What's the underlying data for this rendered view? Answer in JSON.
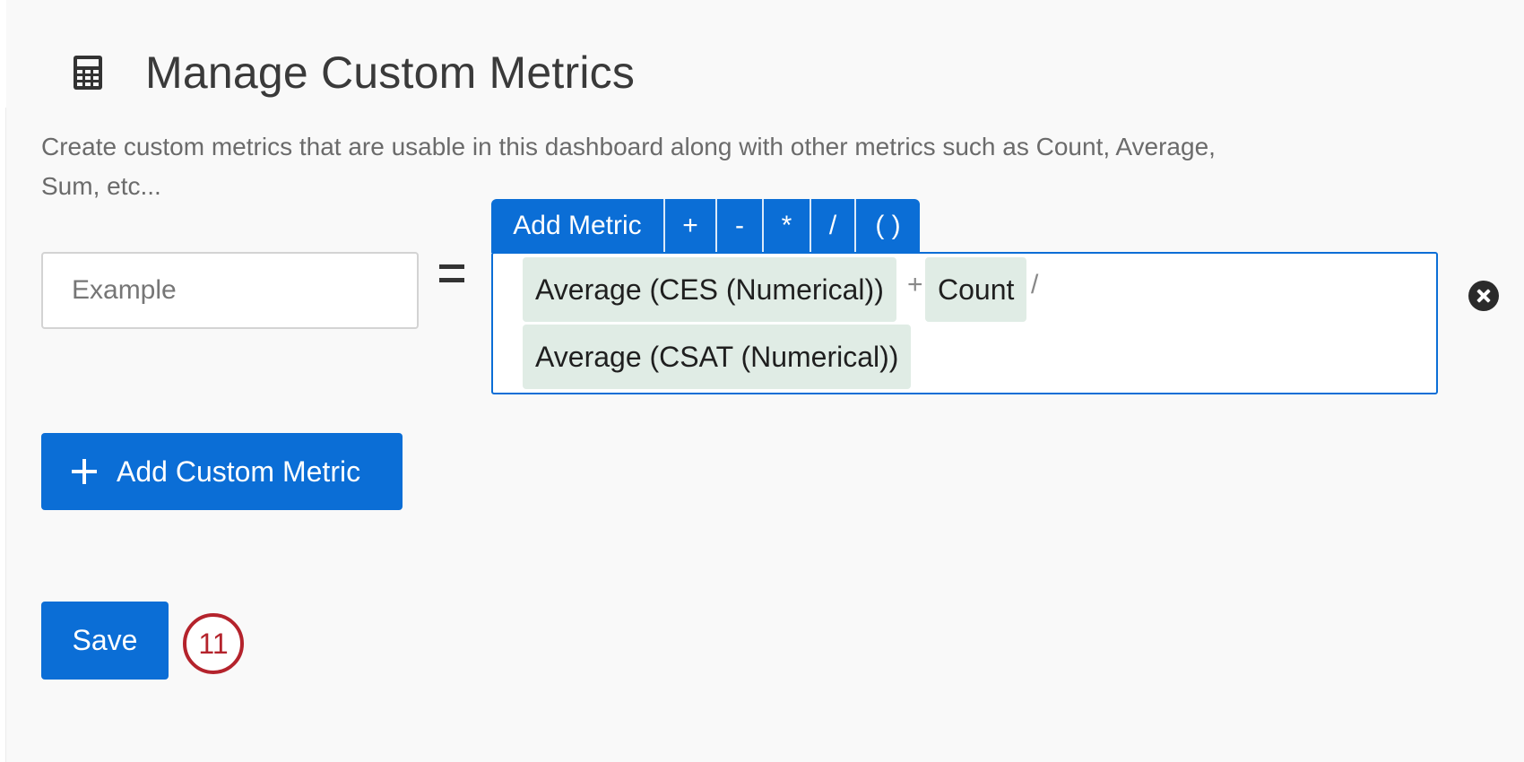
{
  "header": {
    "icon": "calculator-icon",
    "title": "Manage Custom Metrics"
  },
  "description": "Create custom metrics that are usable in this dashboard along with other metrics such as Count, Average, Sum, etc...",
  "metric_row": {
    "name_input": {
      "value": "",
      "placeholder": "Example"
    },
    "equals": "=",
    "toolbar": {
      "add_metric_label": "Add Metric",
      "plus_label": "+",
      "minus_label": "-",
      "times_label": "*",
      "divide_label": "/",
      "parens_label": "( )"
    },
    "formula": {
      "token1": "Average (CES (Numerical))",
      "op1": "+",
      "token2": "Count",
      "op2": "/",
      "token3": "Average (CSAT (Numerical))"
    },
    "remove_icon": "close-circle-icon"
  },
  "add_custom_metric_label": "Add Custom Metric",
  "save_label": "Save",
  "step_badge": "11",
  "colors": {
    "primary": "#0b6ed6",
    "token_bg": "#e0ece5",
    "badge": "#b4232c",
    "background": "#f9f9f9"
  }
}
